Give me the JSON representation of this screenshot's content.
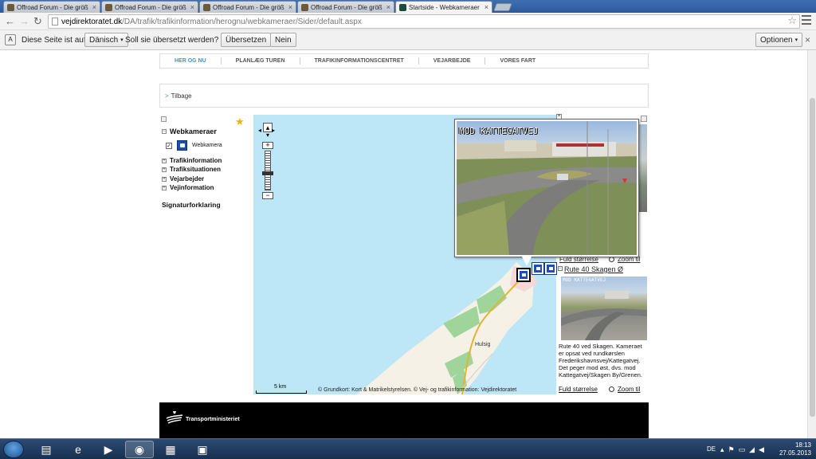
{
  "browser": {
    "tabs": [
      {
        "title": "Offroad Forum - Die größ",
        "close": "×"
      },
      {
        "title": "Offroad Forum - Die größ",
        "close": "×"
      },
      {
        "title": "Offroad Forum - Die größ",
        "close": "×"
      },
      {
        "title": "Offroad Forum - Die größ",
        "close": "×"
      },
      {
        "title": "Startside - Webkameraer",
        "close": "×"
      }
    ],
    "url_domain": "vejdirektoratet.dk",
    "url_path": "/DA/trafik/trafikinformation/herognu/webkameraer/Sider/default.aspx"
  },
  "translate": {
    "prefix": "Diese Seite ist auf",
    "language": "Dänisch",
    "question": "Soll sie übersetzt werden?",
    "translate_btn": "Übersetzen",
    "no_btn": "Nein",
    "options_btn": "Optionen"
  },
  "site": {
    "nav": [
      "HER OG NU",
      "PLANLÆG TUREN",
      "TRAFIKINFORMATIONSCENTRET",
      "VEJARBEJDE",
      "VORES FART"
    ],
    "back": "Tilbage",
    "layers": {
      "webcams_heading": "Webkameraer",
      "webcam_item": "Webkamera",
      "groups": [
        "Trafikinformation",
        "Trafiksituationen",
        "Vejarbejder",
        "Vejinformation"
      ],
      "legend": "Signaturforklaring"
    },
    "map": {
      "scale": "5 km",
      "copyright": "© Grundkort: Kort & Matrikelstyrelsen. © Vej- og trafikinformation: Vejdirektoratet",
      "place": "Hulsig",
      "popup_caption": "MOD KATTEGATVEJ"
    },
    "side": {
      "link_size_top": "Fuld størrelse",
      "zoom_top": "Zoom til",
      "cam_title": "Rute 40 Skagen Ø",
      "cam_tag": "MOD KATTEGATVEJ",
      "description": "Rute 40 ved Skagen. Kameraet er opsat ved rundkørslen Frederikshavnsvej/Kattegatvej. Det peger mod øst, dvs. mod Kattegatvej/Skagen By/Grenen.",
      "link_size": "Fuld størrelse",
      "zoom": "Zoom til"
    },
    "footer_brand": "Transportministeriet"
  },
  "taskbar": {
    "lang": "DE",
    "time": "18:13",
    "date": "27.05.2013"
  }
}
